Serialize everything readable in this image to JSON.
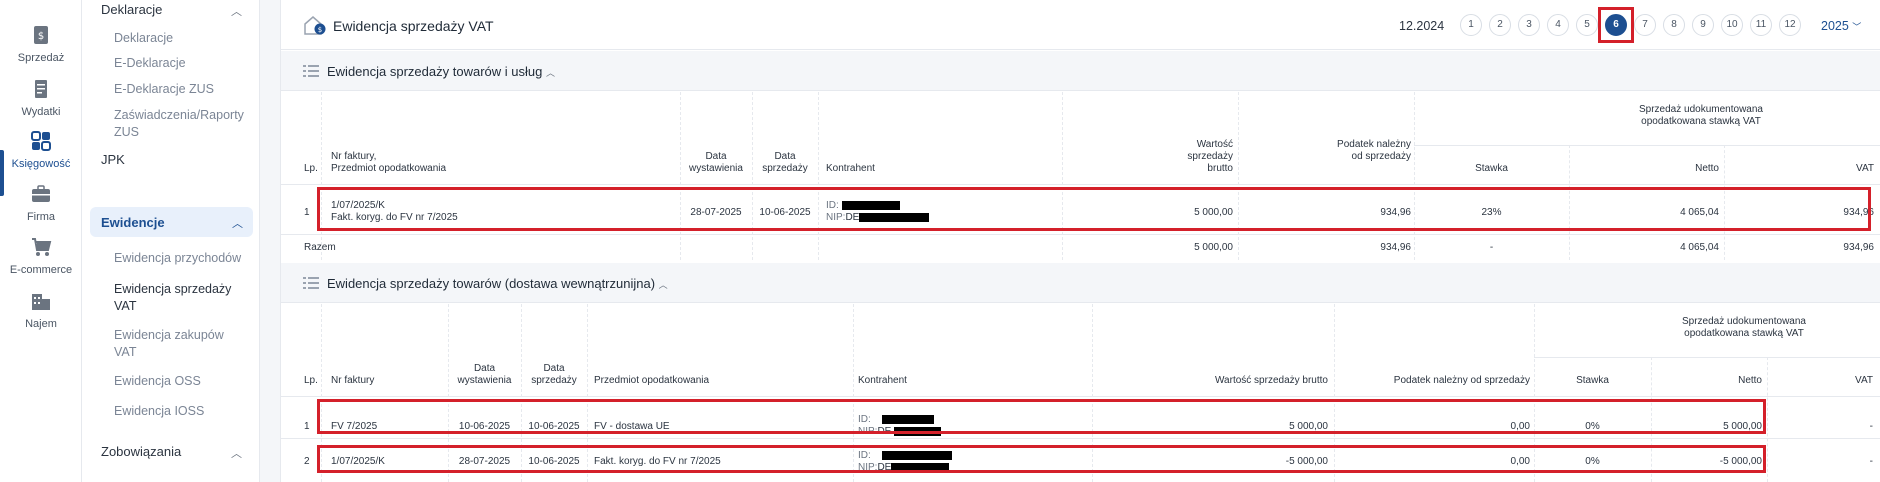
{
  "rail": {
    "items": [
      {
        "label": "Sprzedaż",
        "icon": "invoice-dollar-icon"
      },
      {
        "label": "Wydatki",
        "icon": "receipt-icon"
      },
      {
        "label": "Księgowość",
        "icon": "grid-icon"
      },
      {
        "label": "Firma",
        "icon": "briefcase-icon"
      },
      {
        "label": "E-commerce",
        "icon": "cart-icon"
      },
      {
        "label": "Najem",
        "icon": "building-icon"
      }
    ]
  },
  "subnav": {
    "deklaracje_group": "Deklaracje",
    "deklaracje_items": [
      "Deklaracje",
      "E-Deklaracje",
      "E-Deklaracje ZUS",
      "Zaświadczenia/Raporty ZUS"
    ],
    "jpk": "JPK",
    "ewidencje_group": "Ewidencje",
    "ewidencje_items": [
      "Ewidencja przychodów",
      "Ewidencja sprzedaży VAT",
      "Ewidencja zakupów VAT",
      "Ewidencja OSS",
      "Ewidencja IOSS"
    ],
    "zobowiazania_group": "Zobowiązania"
  },
  "header": {
    "title": "Ewidencja sprzedaży VAT",
    "period": "12.2024",
    "months": [
      "1",
      "2",
      "3",
      "4",
      "5",
      "6",
      "7",
      "8",
      "9",
      "10",
      "11",
      "12"
    ],
    "selected_month": "6",
    "year": "2025"
  },
  "section1": {
    "title": "Ewidencja sprzedaży towarów i usług",
    "headers": {
      "lp": "Lp.",
      "nr": "Nr faktury,",
      "nr2": "Przedmiot opodatkowania",
      "data_wyst": "Data wystawienia",
      "data_sprz": "Data sprzedaży",
      "kontrahent": "Kontrahent",
      "wartosc": "Wartość sprzedaży brutto",
      "podatek": "Podatek należny od sprzedaży",
      "group": "Sprzedaż udokumentowana opodatkowana stawką VAT",
      "stawka": "Stawka",
      "netto": "Netto",
      "vat": "VAT"
    },
    "rows": [
      {
        "lp": "1",
        "nr": "1/07/2025/K",
        "przedmiot": "Fakt. koryg. do FV nr 7/2025",
        "data_wyst": "28-07-2025",
        "data_sprz": "10-06-2025",
        "id_label": "ID:",
        "nip_label": "NIP:",
        "nip_prefix": "DE",
        "wartosc": "5 000,00",
        "podatek": "934,96",
        "stawka": "23%",
        "netto": "4 065,04",
        "vat": "934,96"
      }
    ],
    "total": {
      "label": "Razem",
      "wartosc": "5 000,00",
      "podatek": "934,96",
      "stawka": "-",
      "netto": "4 065,04",
      "vat": "934,96"
    }
  },
  "section2": {
    "title": "Ewidencja sprzedaży towarów (dostawa wewnątrzunijna)",
    "headers": {
      "lp": "Lp.",
      "nr": "Nr faktury",
      "data_wyst": "Data wystawienia",
      "data_sprz": "Data sprzedaży",
      "przedmiot": "Przedmiot opodatkowania",
      "kontrahent": "Kontrahent",
      "wartosc": "Wartość sprzedaży brutto",
      "podatek": "Podatek należny od sprzedaży",
      "group": "Sprzedaż udokumentowana opodatkowana stawką VAT",
      "stawka": "Stawka",
      "netto": "Netto",
      "vat": "VAT"
    },
    "rows": [
      {
        "lp": "1",
        "nr": "FV 7/2025",
        "data_wyst": "10-06-2025",
        "data_sprz": "10-06-2025",
        "przedmiot": "FV - dostawa UE",
        "id_label": "ID:",
        "nip_label": "NIP:",
        "nip_prefix": "DE",
        "wartosc": "5 000,00",
        "podatek": "0,00",
        "stawka": "0%",
        "netto": "5 000,00",
        "vat": "-"
      },
      {
        "lp": "2",
        "nr": "1/07/2025/K",
        "data_wyst": "28-07-2025",
        "data_sprz": "10-06-2025",
        "przedmiot": "Fakt. koryg. do FV nr 7/2025",
        "id_label": "ID:",
        "nip_label": "NIP:",
        "nip_prefix": "DE",
        "wartosc": "-5 000,00",
        "podatek": "0,00",
        "stawka": "0%",
        "netto": "-5 000,00",
        "vat": "-"
      }
    ]
  },
  "colors": {
    "accent": "#1d4f91",
    "highlight": "#d4202a"
  }
}
